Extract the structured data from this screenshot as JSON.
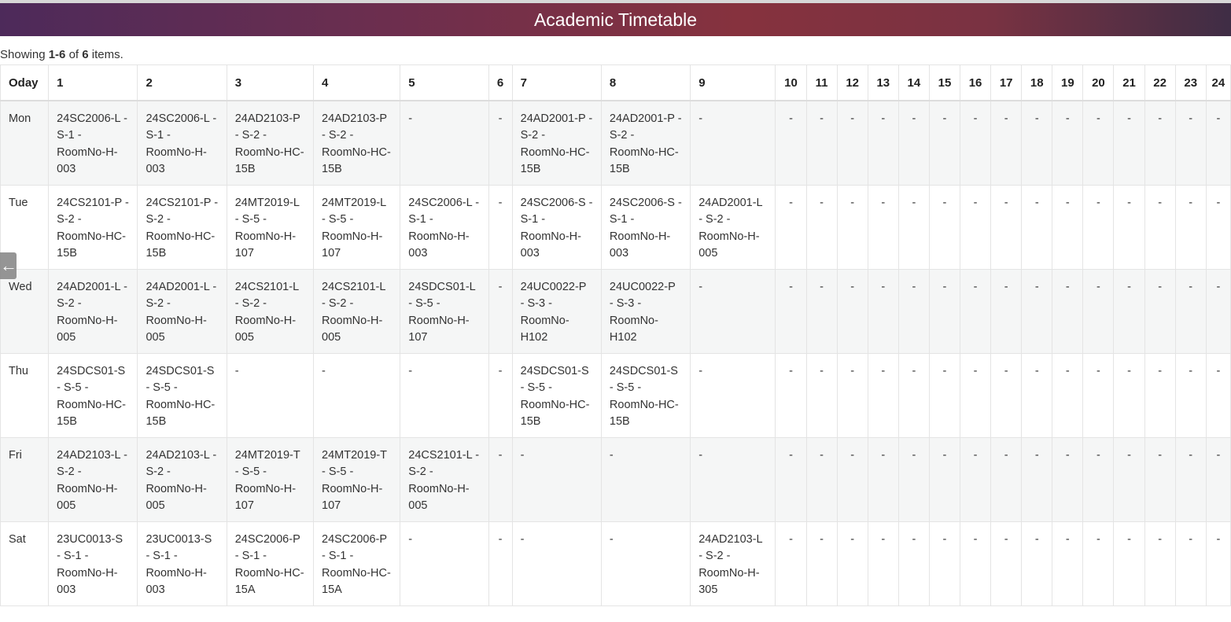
{
  "title": "Academic Timetable",
  "summary": {
    "prefix": "Showing ",
    "range": "1-6",
    "mid": " of ",
    "total": "6",
    "suffix": " items."
  },
  "columns": [
    "Oday",
    "1",
    "2",
    "3",
    "4",
    "5",
    "6",
    "7",
    "8",
    "9",
    "10",
    "11",
    "12",
    "13",
    "14",
    "15",
    "16",
    "17",
    "18",
    "19",
    "20",
    "21",
    "22",
    "23",
    "24"
  ],
  "rows": [
    {
      "day": "Mon",
      "cells": [
        "24SC2006-L - S-1 - RoomNo-H-003",
        "24SC2006-L - S-1 - RoomNo-H-003",
        "24AD2103-P - S-2 - RoomNo-HC-15B",
        "24AD2103-P - S-2 - RoomNo-HC-15B",
        "-",
        "-",
        "24AD2001-P - S-2 - RoomNo-HC-15B",
        "24AD2001-P - S-2 - RoomNo-HC-15B",
        "-",
        "-",
        "-",
        "-",
        "-",
        "-",
        "-",
        "-",
        "-",
        "-",
        "-",
        "-",
        "-",
        "-",
        "-",
        "-"
      ]
    },
    {
      "day": "Tue",
      "cells": [
        "24CS2101-P - S-2 - RoomNo-HC-15B",
        "24CS2101-P - S-2 - RoomNo-HC-15B",
        "24MT2019-L - S-5 - RoomNo-H-107",
        "24MT2019-L - S-5 - RoomNo-H-107",
        "24SC2006-L - S-1 - RoomNo-H-003",
        "-",
        "24SC2006-S - S-1 - RoomNo-H-003",
        "24SC2006-S - S-1 - RoomNo-H-003",
        "24AD2001-L - S-2 - RoomNo-H-005",
        "-",
        "-",
        "-",
        "-",
        "-",
        "-",
        "-",
        "-",
        "-",
        "-",
        "-",
        "-",
        "-",
        "-",
        "-"
      ]
    },
    {
      "day": "Wed",
      "cells": [
        "24AD2001-L - S-2 - RoomNo-H-005",
        "24AD2001-L - S-2 - RoomNo-H-005",
        "24CS2101-L - S-2 - RoomNo-H-005",
        "24CS2101-L - S-2 - RoomNo-H-005",
        "24SDCS01-L - S-5 - RoomNo-H-107",
        "-",
        "24UC0022-P - S-3 - RoomNo-H102",
        "24UC0022-P - S-3 - RoomNo-H102",
        "-",
        "-",
        "-",
        "-",
        "-",
        "-",
        "-",
        "-",
        "-",
        "-",
        "-",
        "-",
        "-",
        "-",
        "-",
        "-"
      ]
    },
    {
      "day": "Thu",
      "cells": [
        "24SDCS01-S - S-5 - RoomNo-HC-15B",
        "24SDCS01-S - S-5 - RoomNo-HC-15B",
        "-",
        "-",
        "-",
        "-",
        "24SDCS01-S - S-5 - RoomNo-HC-15B",
        "24SDCS01-S - S-5 - RoomNo-HC-15B",
        "-",
        "-",
        "-",
        "-",
        "-",
        "-",
        "-",
        "-",
        "-",
        "-",
        "-",
        "-",
        "-",
        "-",
        "-",
        "-"
      ]
    },
    {
      "day": "Fri",
      "cells": [
        "24AD2103-L - S-2 - RoomNo-H-005",
        "24AD2103-L - S-2 - RoomNo-H-005",
        "24MT2019-T - S-5 - RoomNo-H-107",
        "24MT2019-T - S-5 - RoomNo-H-107",
        "24CS2101-L - S-2 - RoomNo-H-005",
        "-",
        "-",
        "-",
        "-",
        "-",
        "-",
        "-",
        "-",
        "-",
        "-",
        "-",
        "-",
        "-",
        "-",
        "-",
        "-",
        "-",
        "-",
        "-"
      ]
    },
    {
      "day": "Sat",
      "cells": [
        "23UC0013-S - S-1 - RoomNo-H-003",
        "23UC0013-S - S-1 - RoomNo-H-003",
        "24SC2006-P - S-1 - RoomNo-HC-15A",
        "24SC2006-P - S-1 - RoomNo-HC-15A",
        "-",
        "-",
        "-",
        "-",
        "24AD2103-L - S-2 - RoomNo-H-305",
        "-",
        "-",
        "-",
        "-",
        "-",
        "-",
        "-",
        "-",
        "-",
        "-",
        "-",
        "-",
        "-",
        "-",
        "-"
      ]
    }
  ],
  "side_toggle_icon": "arrow-left-icon"
}
